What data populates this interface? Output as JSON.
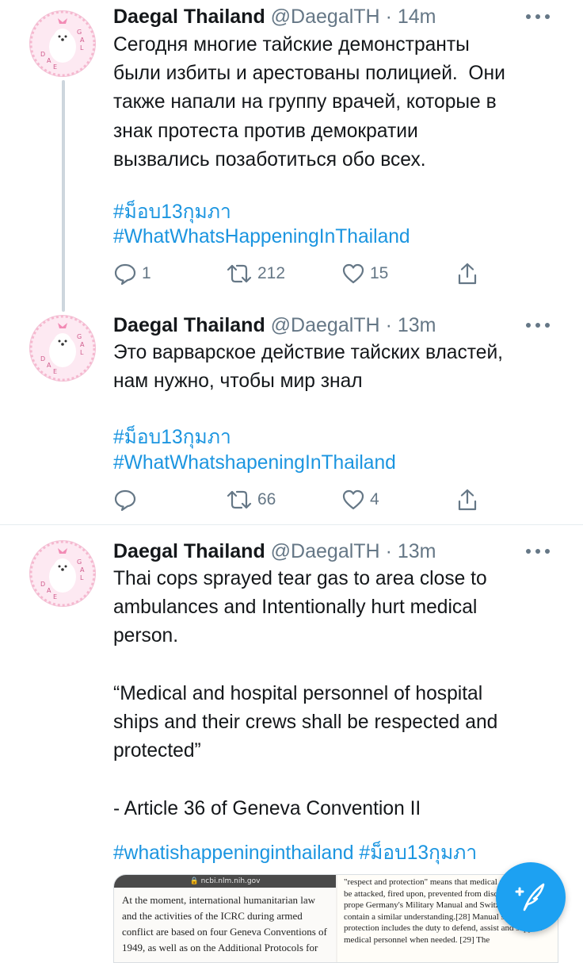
{
  "tweets": [
    {
      "name": "Daegal Thailand",
      "handle": "@DaegalTH",
      "dot": "·",
      "time": "14m",
      "text": "Сегодня многие тайские демонстранты\nбыли избиты и арестованы полицией.  Они\nтакже напали на группу врачей, которые в\nзнак протеста против демократии\nвызвались позаботиться обо всех.",
      "hashtags": [
        "#ม็อบ13กุมภา",
        "#WhatWhatsHappeningInThailand"
      ],
      "replies": "1",
      "retweets": "212",
      "likes": "15"
    },
    {
      "name": "Daegal Thailand",
      "handle": "@DaegalTH",
      "dot": "·",
      "time": "13m",
      "text": "Это варварское действие тайских властей,\nнам нужно, чтобы мир знал",
      "hashtags": [
        "#ม็อบ13กุมภา",
        "#WhatWhatshapeningInThailand"
      ],
      "replies": "",
      "retweets": "66",
      "likes": "4"
    },
    {
      "name": "Daegal Thailand",
      "handle": "@DaegalTH",
      "dot": "·",
      "time": "13m",
      "text": "Thai cops sprayed tear gas to area close to\nambulances and Intentionally hurt medical\nperson.\n\n“Medical and hospital personnel of hospital\nships and their crews shall be respected and\nprotected”\n\n- Article 36 of Geneva Convention II",
      "hashtags": [
        "#whatishappeninginthailand",
        "#ม็อบ13กุมภา"
      ]
    }
  ],
  "avatar_letters": [
    "D",
    "A",
    "E",
    "G",
    "A",
    "L"
  ],
  "media": {
    "url": "🔒 ncbi.nlm.nih.gov",
    "left_text": "At the moment, international humanitarian law and the activities of the ICRC during armed conflict are based on four Geneva Conventions of 1949, as well as on the Additional Protocols for",
    "right_text": "\"respect and protection\" means that medical not knowingly be attacked, fired upon, prevented from discharging their prope Germany's Military Manual and Switzerland Manual contain a similar understanding.[28] Manual states that protection includes the duty to defend, assist and support medical personnel when needed. [29] The"
  },
  "colors": {
    "accent": "#1b95e0",
    "secondary_text": "#657786",
    "fab": "#1da1f2",
    "thread_line": "#cdd6dd"
  },
  "icons": [
    "reply-icon",
    "retweet-icon",
    "like-icon",
    "share-icon",
    "more-icon",
    "compose-feather-icon"
  ]
}
